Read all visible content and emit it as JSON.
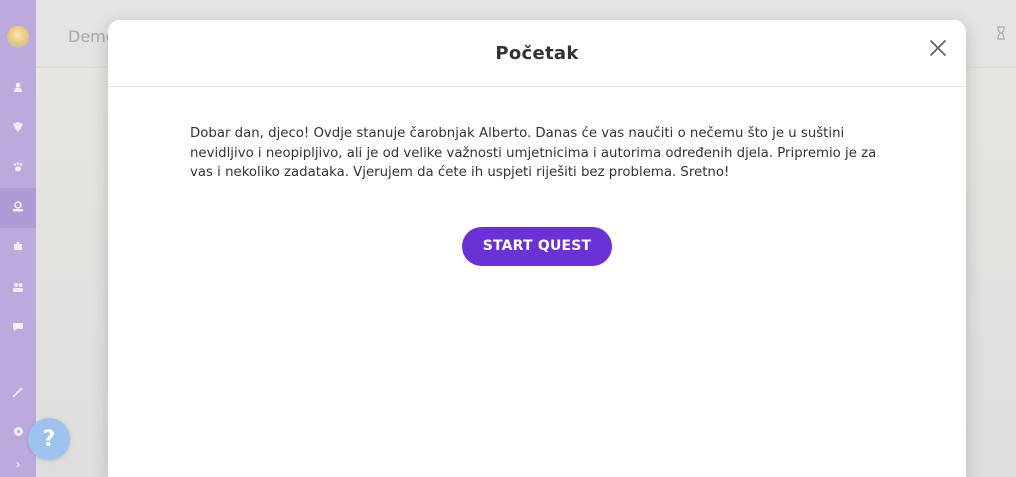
{
  "background": {
    "breadcrumb": "Demo",
    "sidebar": {
      "items": [
        {
          "icon": "user-icon"
        },
        {
          "icon": "award-icon"
        },
        {
          "icon": "paw-icon"
        },
        {
          "icon": "map-icon"
        },
        {
          "icon": "puzzle-icon"
        },
        {
          "icon": "group-icon"
        },
        {
          "icon": "chat-icon"
        },
        {
          "icon": "magic-wand-icon"
        },
        {
          "icon": "settings-icon"
        }
      ],
      "expand_glyph": "›"
    },
    "help_glyph": "?"
  },
  "modal": {
    "title": "Početak",
    "close_glyph": "×",
    "text": "Dobar dan, djeco! Ovdje stanuje čarobnjak Alberto. Danas će vas naučiti o nečemu što je u suštini nevidljivo i neopipljivo, ali je od velike važnosti umjetnicima i autorima određenih djela. Pripremio je za vas i nekoliko zadataka. Vjerujem da ćete ih uspjeti riješiti bez problema. Sretno!",
    "start_button": "START QUEST"
  },
  "colors": {
    "accent": "#6a31d6",
    "sidebar": "#c7b3ea",
    "help": "#9ec2ee"
  }
}
